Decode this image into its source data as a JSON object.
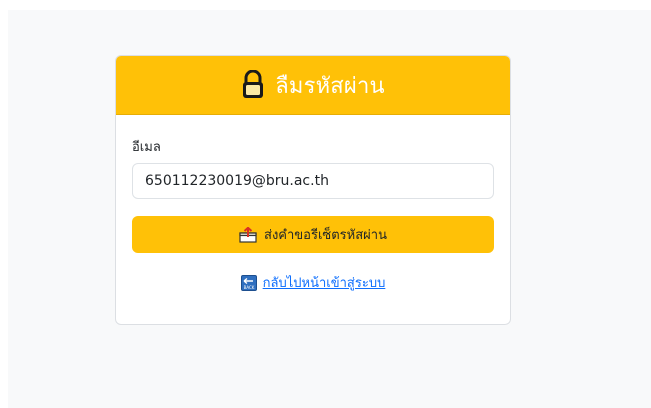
{
  "header": {
    "icon": "lock-icon",
    "title": "ลืมรหัสผ่าน",
    "background_color": "#ffc107",
    "title_color": "#ffffff"
  },
  "form": {
    "email_label": "อีเมล",
    "email_value": "650112230019@bru.ac.th",
    "submit_label": "ส่งคำขอรีเซ็ตรหัสผ่าน",
    "submit_icon": "send-box-icon",
    "submit_color": "#ffc107"
  },
  "footer": {
    "back_link_label": "กลับไปหน้าเข้าสู่ระบบ",
    "back_icon": "back-icon",
    "back_icon_text": "BACK",
    "link_color": "#0d6efd"
  }
}
